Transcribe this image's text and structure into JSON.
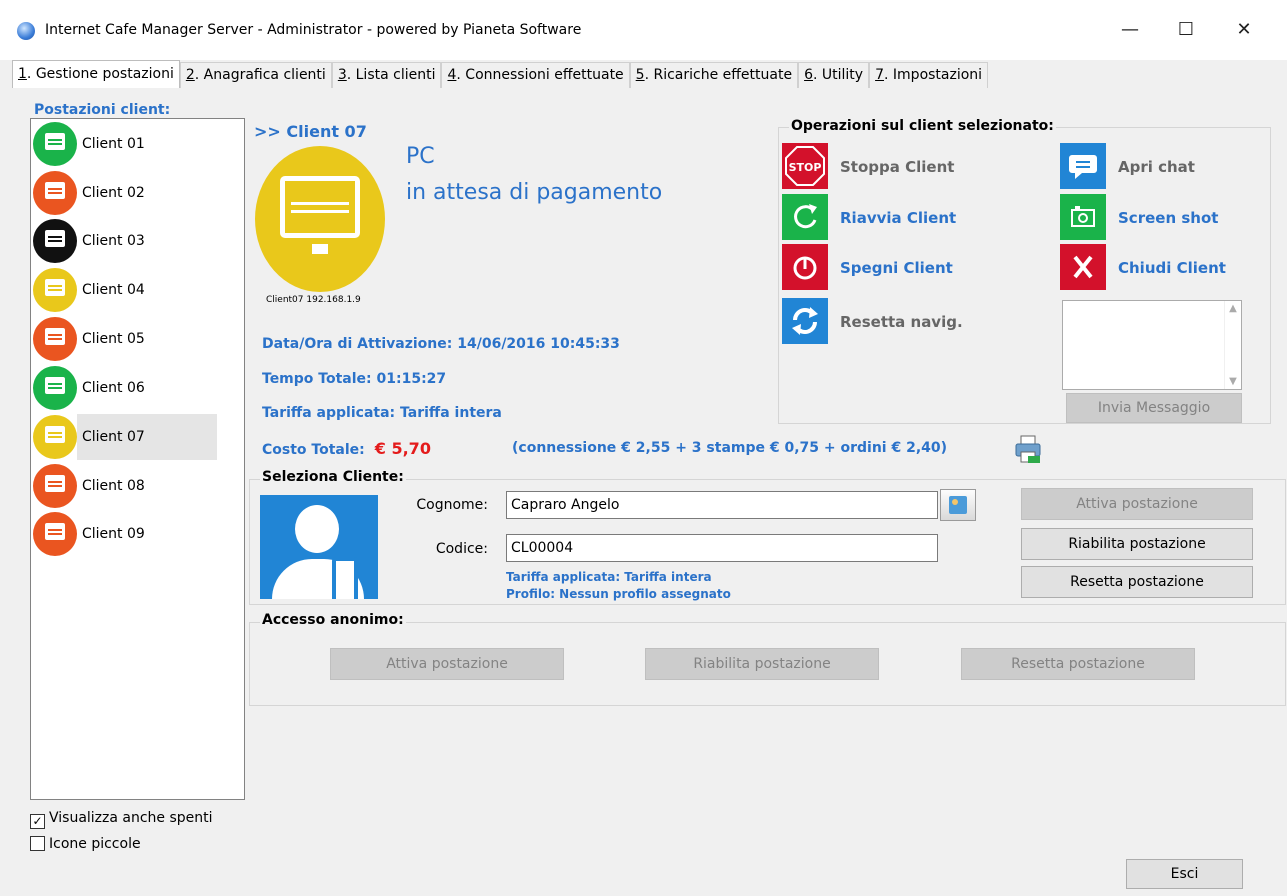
{
  "window": {
    "title": "Internet Cafe Manager Server - Administrator - powered by Pianeta Software",
    "minimize": "—",
    "maximize": "☐",
    "close": "✕"
  },
  "tabs": [
    {
      "key": "1",
      "label": ". Gestione postazioni"
    },
    {
      "key": "2",
      "label": ". Anagrafica clienti"
    },
    {
      "key": "3",
      "label": ". Lista clienti"
    },
    {
      "key": "4",
      "label": ". Connessioni effettuate"
    },
    {
      "key": "5",
      "label": ". Ricariche effettuate"
    },
    {
      "key": "6",
      "label": ". Utility"
    },
    {
      "key": "7",
      "label": ". Impostazioni"
    }
  ],
  "clients_caption": "Postazioni client:",
  "clients": [
    {
      "label": "Client 01",
      "color": "#1ab34a"
    },
    {
      "label": "Client 02",
      "color": "#ea5520"
    },
    {
      "label": "Client 03",
      "color": "#111111"
    },
    {
      "label": "Client 04",
      "color": "#e9c81b"
    },
    {
      "label": "Client 05",
      "color": "#ea5520"
    },
    {
      "label": "Client 06",
      "color": "#1ab34a"
    },
    {
      "label": "Client 07",
      "color": "#e9c81b"
    },
    {
      "label": "Client 08",
      "color": "#ea5520"
    },
    {
      "label": "Client 09",
      "color": "#ea5520"
    }
  ],
  "options": {
    "show_off": {
      "label": "Visualizza anche spenti",
      "checked": "✓"
    },
    "small_icons": {
      "label": "Icone piccole",
      "checked": ""
    }
  },
  "selected": {
    "title": ">> Client 07",
    "type": "PC",
    "status": "in attesa di pagamento",
    "ip": "Client07 192.168.1.9",
    "activation": "Data/Ora di Attivazione: 14/06/2016 10:45:33",
    "total_time": "Tempo Totale: 01:15:27",
    "tariff": "Tariffa applicata: Tariffa intera",
    "cost_label": "Costo Totale:",
    "cost_value": "€ 5,70",
    "cost_detail": "(connessione € 2,55 + 3 stampe € 0,75 + ordini € 2,40)"
  },
  "operations": {
    "caption": "Operazioni sul client selezionato:",
    "stop": "Stoppa Client",
    "stop_icon_text": "STOP",
    "chat": "Apri chat",
    "restart": "Riavvia Client",
    "screenshot": "Screen shot",
    "shutdown": "Spegni Client",
    "close": "Chiudi Client",
    "reset_nav": "Resetta navig.",
    "send_message": "Invia Messaggio"
  },
  "customer": {
    "caption": "Seleziona Cliente:",
    "surname_label": "Cognome:",
    "surname_value": "Capraro Angelo",
    "code_label": "Codice:",
    "code_value": "CL00004",
    "tariff": "Tariffa applicata: Tariffa intera",
    "profile": "Profilo: Nessun profilo assegnato",
    "activate": "Attiva postazione",
    "reenable": "Riabilita postazione",
    "reset": "Resetta postazione"
  },
  "anonymous": {
    "caption": "Accesso anonimo:",
    "activate": "Attiva postazione",
    "reenable": "Riabilita postazione",
    "reset": "Resetta postazione"
  },
  "exit": "Esci"
}
